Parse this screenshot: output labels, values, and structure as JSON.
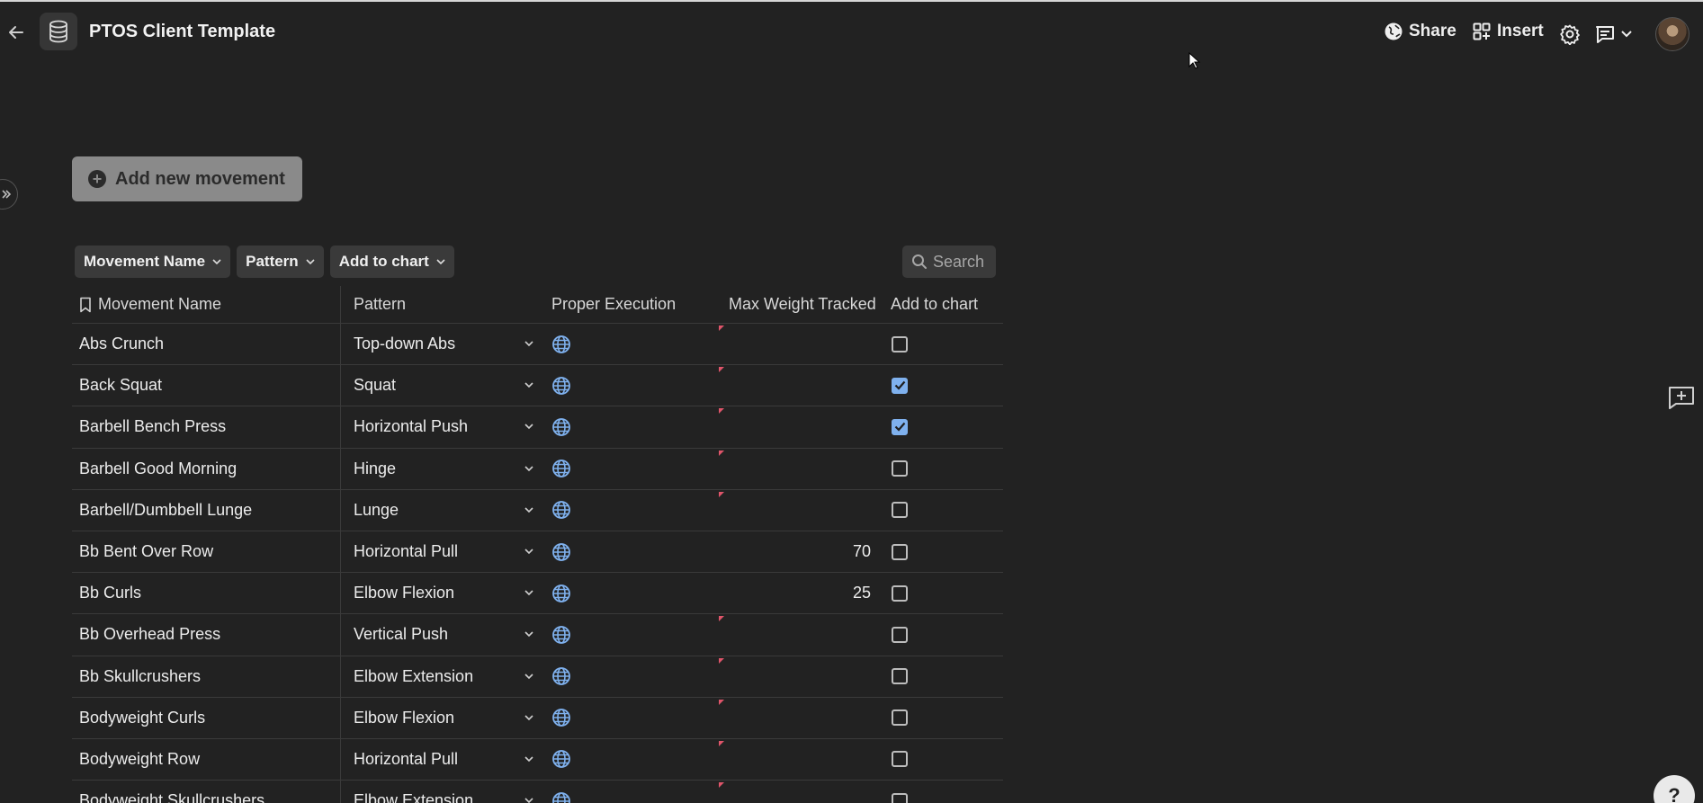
{
  "header": {
    "title": "PTOS Client Template",
    "share_label": "Share",
    "insert_label": "Insert",
    "icons": [
      "back-arrow-icon",
      "database-icon",
      "globe-share-icon",
      "grid-insert-icon",
      "gear-icon",
      "comment-icon",
      "chevron-down-icon"
    ]
  },
  "add_button_label": "Add new movement",
  "filters": {
    "chips": [
      "Movement Name",
      "Pattern",
      "Add to chart"
    ],
    "search_placeholder": "Search"
  },
  "table": {
    "columns": [
      "Movement Name",
      "Pattern",
      "Proper Execution",
      "Max Weight Tracked",
      "Add to chart"
    ],
    "rows": [
      {
        "name": "Abs Crunch",
        "pattern": "Top-down Abs",
        "max": "",
        "checked": false
      },
      {
        "name": "Back Squat",
        "pattern": "Squat",
        "max": "",
        "checked": true
      },
      {
        "name": "Barbell Bench Press",
        "pattern": "Horizontal Push",
        "max": "",
        "checked": true
      },
      {
        "name": "Barbell Good Morning",
        "pattern": "Hinge",
        "max": "",
        "checked": false
      },
      {
        "name": "Barbell/Dumbbell Lunge",
        "pattern": "Lunge",
        "max": "",
        "checked": false
      },
      {
        "name": "Bb Bent Over Row",
        "pattern": "Horizontal Pull",
        "max": "70",
        "checked": false
      },
      {
        "name": "Bb Curls",
        "pattern": "Elbow Flexion",
        "max": "25",
        "checked": false
      },
      {
        "name": "Bb Overhead Press",
        "pattern": "Vertical Push",
        "max": "",
        "checked": false
      },
      {
        "name": "Bb Skullcrushers",
        "pattern": "Elbow Extension",
        "max": "",
        "checked": false
      },
      {
        "name": "Bodyweight Curls",
        "pattern": "Elbow Flexion",
        "max": "",
        "checked": false
      },
      {
        "name": "Bodyweight Row",
        "pattern": "Horizontal Pull",
        "max": "",
        "checked": false
      },
      {
        "name": "Bodyweight Skullcrushers",
        "pattern": "Elbow Extension",
        "max": "",
        "checked": false
      }
    ]
  },
  "help_label": "?",
  "colors": {
    "background": "#222222",
    "accent_check": "#7fb1ee",
    "globe": "#7fb1ee",
    "flag": "#e0556a"
  }
}
